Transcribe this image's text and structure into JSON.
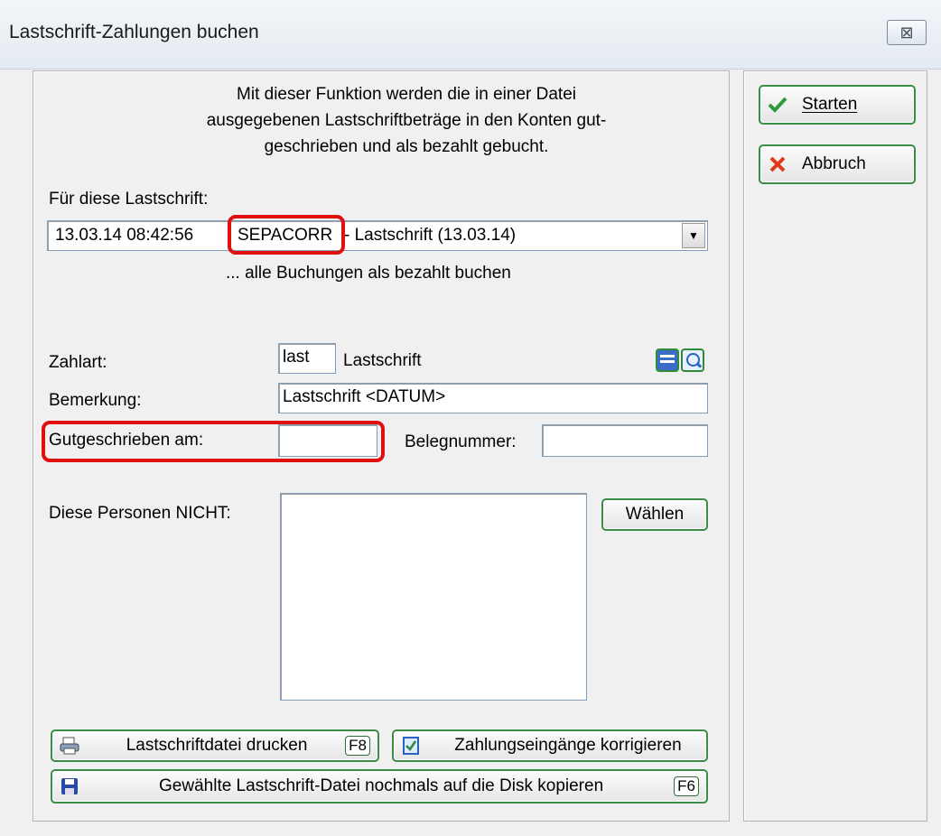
{
  "window": {
    "title": "Lastschrift-Zahlungen buchen",
    "close_symbol": "⊠"
  },
  "intro": {
    "line1": "Mit dieser Funktion werden die in einer Datei",
    "line2": "ausgegebenen Lastschriftbeträge in den Konten gut-",
    "line3": "geschrieben und als bezahlt gebucht."
  },
  "lastschrift": {
    "label": "Für diese Lastschrift:",
    "date": "13.03.14  08:42:56",
    "code": "SEPACORR",
    "rest": "- Lastschrift (13.03.14)",
    "note": "... alle Buchungen als bezahlt buchen"
  },
  "zahlart": {
    "label": "Zahlart:",
    "value": "last",
    "name": "Lastschrift"
  },
  "bemerkung": {
    "label": "Bemerkung:",
    "value": "Lastschrift <DATUM>"
  },
  "gutgeschrieben": {
    "label": "Gutgeschrieben am:",
    "value": " .  ."
  },
  "belegnummer": {
    "label": "Belegnummer:",
    "value": ""
  },
  "personen": {
    "label": "Diese Personen NICHT:",
    "button": "Wählen"
  },
  "buttons": {
    "starten": "Starten",
    "abbruch": "Abbruch",
    "drucken": "Lastschriftdatei drucken",
    "drucken_key": "F8",
    "korrigieren": "Zahlungseingänge korrigieren",
    "kopieren": "Gewählte Lastschrift-Datei nochmals auf die Disk kopieren",
    "kopieren_key": "F6"
  },
  "colors": {
    "accent_green": "#3c8c48",
    "highlight_red": "#e01010"
  }
}
